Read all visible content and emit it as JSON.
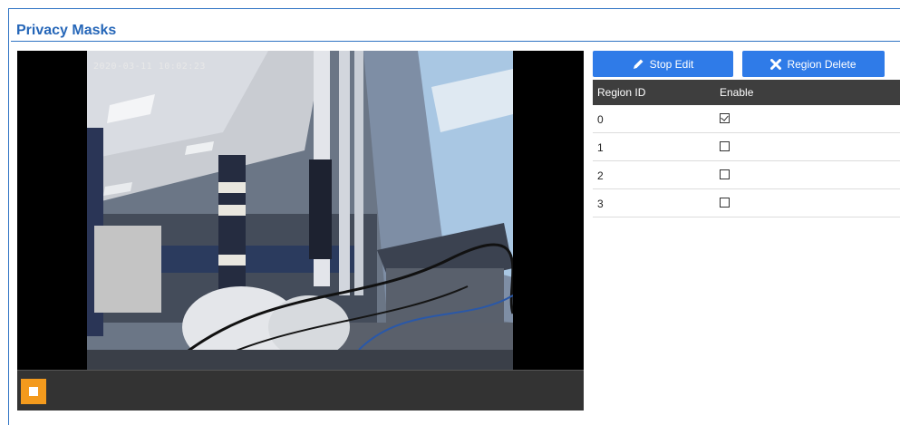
{
  "section": {
    "title": "Privacy Masks"
  },
  "video": {
    "timestamp": "2020-03-11 10:02:23"
  },
  "toolbar": {
    "stop_edit_label": "Stop Edit",
    "region_delete_label": "Region Delete"
  },
  "table": {
    "headers": [
      "Region ID",
      "Enable"
    ],
    "rows": [
      {
        "id": "0",
        "enabled": true
      },
      {
        "id": "1",
        "enabled": false
      },
      {
        "id": "2",
        "enabled": false
      },
      {
        "id": "3",
        "enabled": false
      }
    ]
  },
  "colors": {
    "accent": "#2f7be8",
    "title": "#2566b8",
    "stop_button": "#f39a1d",
    "header_bg": "#3e3e3e"
  },
  "icons": {
    "stop_edit": "pencil-icon",
    "region_delete": "close-x-icon",
    "player_stop": "stop-icon"
  }
}
